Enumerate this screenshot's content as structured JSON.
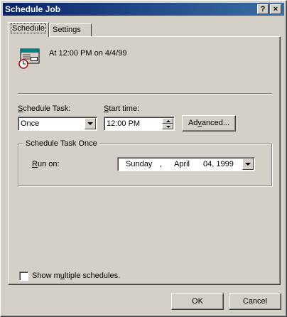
{
  "window": {
    "title": "Schedule Job",
    "help_button": "?",
    "close_button": "×"
  },
  "tabs": [
    {
      "label": "Schedule",
      "active": true
    },
    {
      "label": "Settings",
      "active": false
    }
  ],
  "summary": {
    "icon": "calendar-clock-icon",
    "text": "At 12:00 PM on 4/4/99"
  },
  "schedule_task": {
    "label_prefix": "S",
    "label_rest": "chedule Task:",
    "value": "Once"
  },
  "start_time": {
    "label_prefix": "S",
    "label_rest": "tart time:",
    "value": "12:00 PM"
  },
  "advanced_button": {
    "prefix": "Ad",
    "underlined": "v",
    "rest": "anced..."
  },
  "group": {
    "title": "Schedule Task Once",
    "run_on_prefix": "R",
    "run_on_rest": "un on:",
    "date": {
      "weekday": "Sunday",
      "sep": ",",
      "month": "April",
      "day_year": "04, 1999"
    }
  },
  "show_multiple": {
    "checked": false,
    "prefix": "Show m",
    "underlined": "u",
    "rest": "ltiple schedules."
  },
  "footer": {
    "ok_label": "OK",
    "cancel_label": "Cancel"
  }
}
